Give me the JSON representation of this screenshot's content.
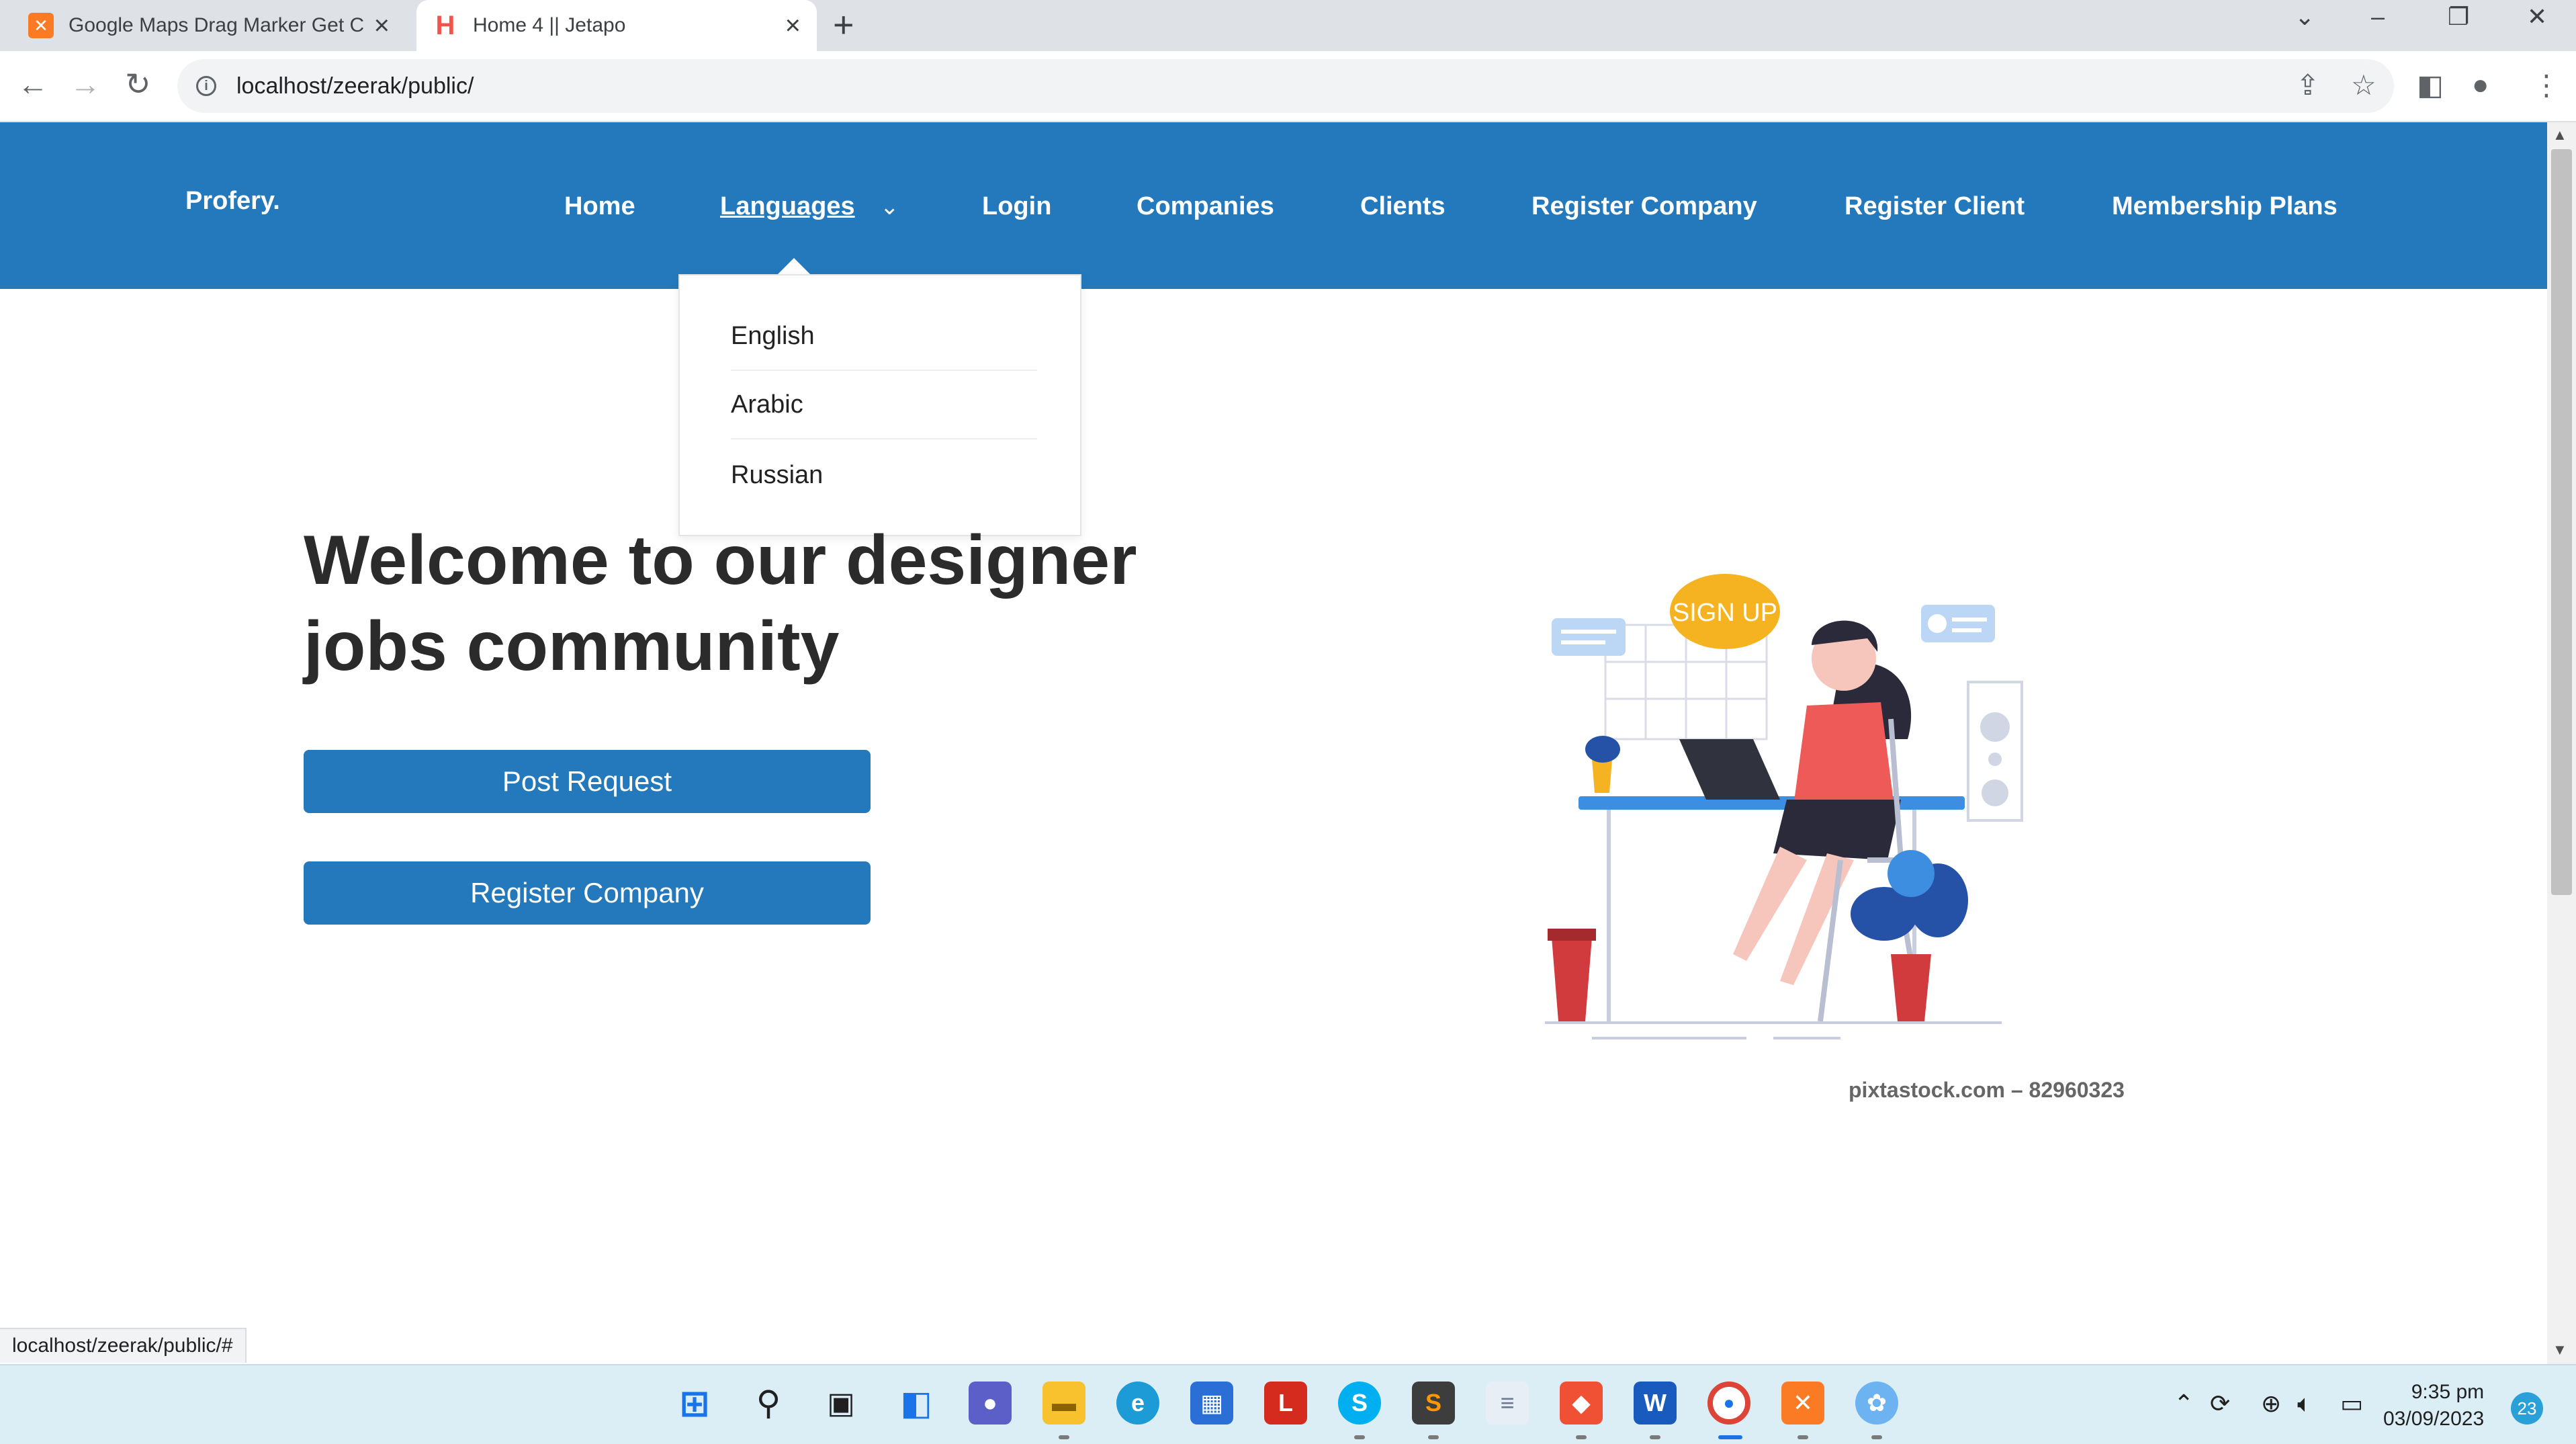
{
  "browser": {
    "tabs": [
      {
        "title": "Google Maps Drag Marker Get C"
      },
      {
        "title": "Home 4 || Jetapo"
      }
    ],
    "url": "localhost/zeerak/public/",
    "status_url": "localhost/zeerak/public/#"
  },
  "site": {
    "logo": "Profery.",
    "nav": {
      "home": "Home",
      "languages": "Languages",
      "login": "Login",
      "companies": "Companies",
      "clients": "Clients",
      "register_company": "Register Company",
      "register_client": "Register Client",
      "membership_plans": "Membership Plans"
    },
    "languages_menu": [
      "English",
      "Arabic",
      "Russian"
    ],
    "hero": {
      "title_line1": "Welcome to our designer",
      "title_line2": "jobs community",
      "post_request": "Post Request",
      "register_company": "Register Company"
    },
    "illustration": {
      "bubble_text": "SIGN UP",
      "watermark": "pixtastock.com – 82960323"
    }
  },
  "taskbar": {
    "time": "9:35 pm",
    "date": "03/09/2023",
    "notifications": "23"
  },
  "colors": {
    "brand_blue": "#2479bd",
    "tab_strip": "#dee1e6",
    "taskbar": "#dbeef6"
  }
}
